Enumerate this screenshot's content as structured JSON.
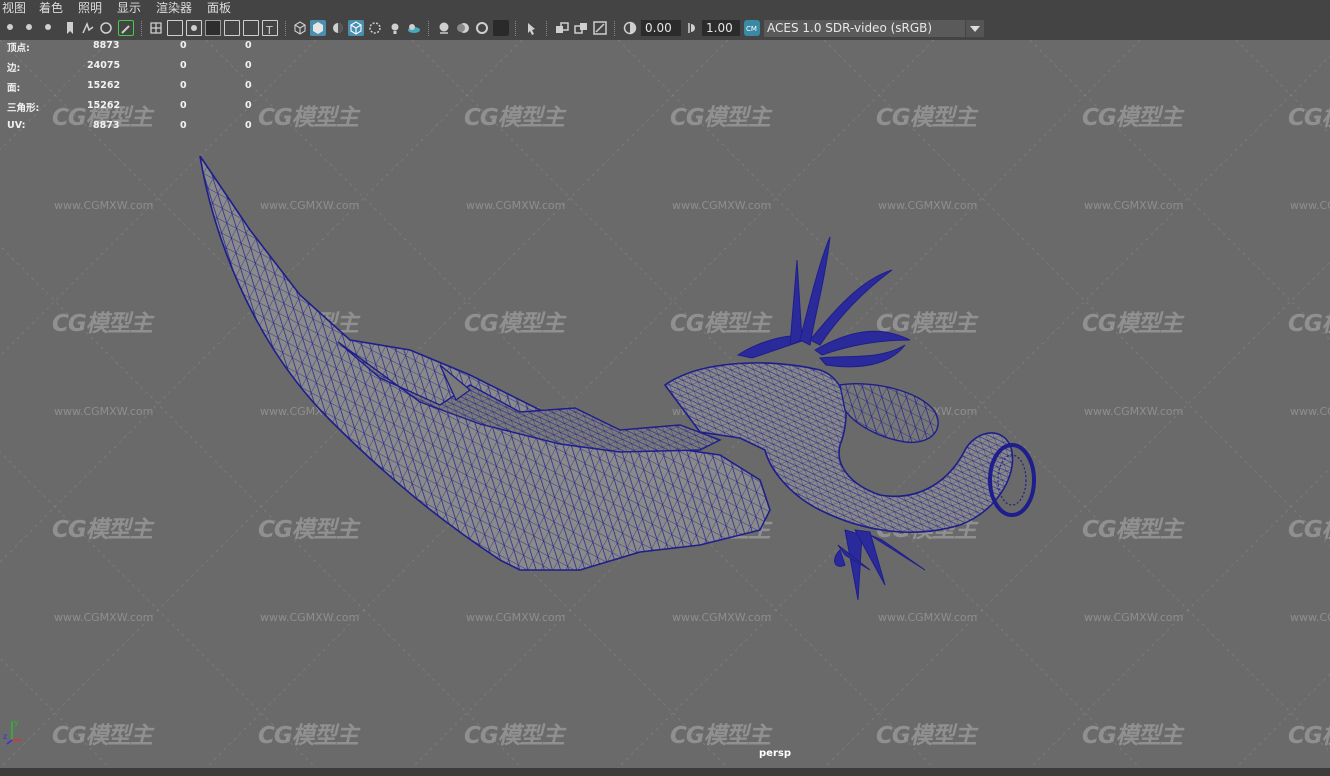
{
  "menu": [
    "视图",
    "着色",
    "照明",
    "显示",
    "渲染器",
    "面板"
  ],
  "toolbar": {
    "exposure": "0.00",
    "gamma": "1.00",
    "colorspace": "ACES 1.0 SDR-video (sRGB)",
    "icons": [
      "camera-icon",
      "camera-attr-icon",
      "bookmark-icon",
      "image-plane-icon",
      "grid-icon",
      "film-gate-icon",
      "resolution-gate-icon",
      "gate-mask-icon",
      "field-chart-icon",
      "safe-action-icon",
      "safe-title-icon",
      "wireframe-icon",
      "smooth-shade-icon",
      "default-material-icon",
      "wireframe-on-shaded-icon",
      "xray-icon",
      "use-all-lights-icon",
      "shadows-icon",
      "screen-space-ao-icon",
      "motion-blur-icon",
      "anti-alias-icon",
      "depth-of-field-icon",
      "isolate-select-icon",
      "xray-joints-icon",
      "xray-active-icon",
      "exposure-icon",
      "gamma-icon",
      "color-management-icon"
    ]
  },
  "hud": {
    "rows": [
      {
        "label": "顶点:",
        "v1": "8873",
        "v2": "0",
        "v3": "0"
      },
      {
        "label": "边:",
        "v1": "24075",
        "v2": "0",
        "v3": "0"
      },
      {
        "label": "面:",
        "v1": "15262",
        "v2": "0",
        "v3": "0"
      },
      {
        "label": "三角形:",
        "v1": "15262",
        "v2": "0",
        "v3": "0"
      },
      {
        "label": "UV:",
        "v1": "8873",
        "v2": "0",
        "v3": "0"
      }
    ]
  },
  "viewport": {
    "camera": "persp",
    "axis_x": "x",
    "axis_y": "y",
    "axis_z": "z",
    "wire_color": "#1e1e8c"
  },
  "watermark": {
    "logo": "CG模型主",
    "url": "www.CGMXW.com"
  }
}
